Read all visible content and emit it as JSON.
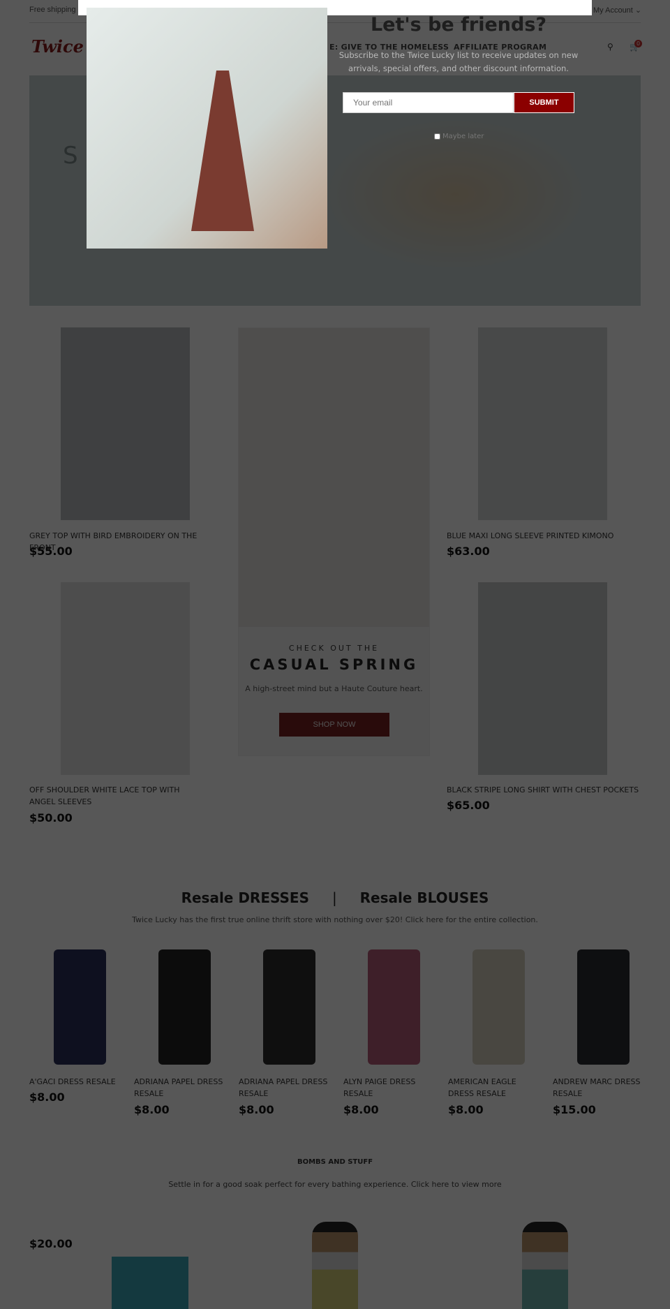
{
  "topbar": {
    "shipping": "Free shipping",
    "account": "My Account ⌄"
  },
  "header": {
    "logo": "Twice Lucky",
    "nav": [
      "E: GIVE TO THE HOMELESS",
      "AFFILIATE PROGRAM"
    ],
    "cart_count": "0"
  },
  "hero": {
    "partial_text": "S"
  },
  "featured": [
    {
      "title": "GREY TOP WITH BIRD EMBROIDERY ON THE FRONT",
      "price": "$55.00"
    },
    {
      "title": "BLUE MAXI LONG SLEEVE PRINTED KIMONO",
      "price": "$63.00"
    },
    {
      "title": "OFF SHOULDER WHITE LACE TOP WITH ANGEL SLEEVES",
      "price": "$50.00"
    },
    {
      "title": "BLACK STRIPE LONG SHIRT WITH CHEST POCKETS",
      "price": "$65.00"
    }
  ],
  "promo": {
    "kicker": "CHECK OUT THE",
    "title": "CASUAL SPRING",
    "tagline": "A high-street mind but a Haute Couture heart.",
    "button": "SHOP NOW"
  },
  "resale": {
    "tab1": "Resale DRESSES",
    "sep": "|",
    "tab2": "Resale BLOUSES",
    "subtitle": "Twice Lucky has the first true online thrift store with nothing over $20! Click here for the entire collection.",
    "products": [
      {
        "title": "A'GACI DRESS RESALE",
        "price": "$8.00",
        "color": "#2a2f5a"
      },
      {
        "title": "ADRIANA PAPEL DRESS RESALE",
        "price": "$8.00",
        "color": "#222"
      },
      {
        "title": "ADRIANA PAPEL DRESS RESALE",
        "price": "$8.00",
        "color": "#2b2b2b"
      },
      {
        "title": "ALYN PAIGE DRESS RESALE",
        "price": "$8.00",
        "color": "#b55a7a"
      },
      {
        "title": "AMERICAN EAGLE DRESS RESALE",
        "price": "$8.00",
        "color": "#d8d2bf"
      },
      {
        "title": "ANDREW MARC DRESS RESALE",
        "price": "$15.00",
        "color": "#2a2d33"
      }
    ]
  },
  "bombs": {
    "title": "BOMBS AND STUFF",
    "subtitle": "Settle in for a good soak perfect for every bathing experience. Click here to view more",
    "price": "$20.00"
  },
  "popup": {
    "heading": "Let's be friends?",
    "subtitle": "Subscribe to the Twice Lucky list to receive updates on new arrivals, special offers, and other discount information.",
    "email_placeholder": "Your email",
    "submit": "SUBMIT",
    "maybe_later": "Maybe later"
  }
}
